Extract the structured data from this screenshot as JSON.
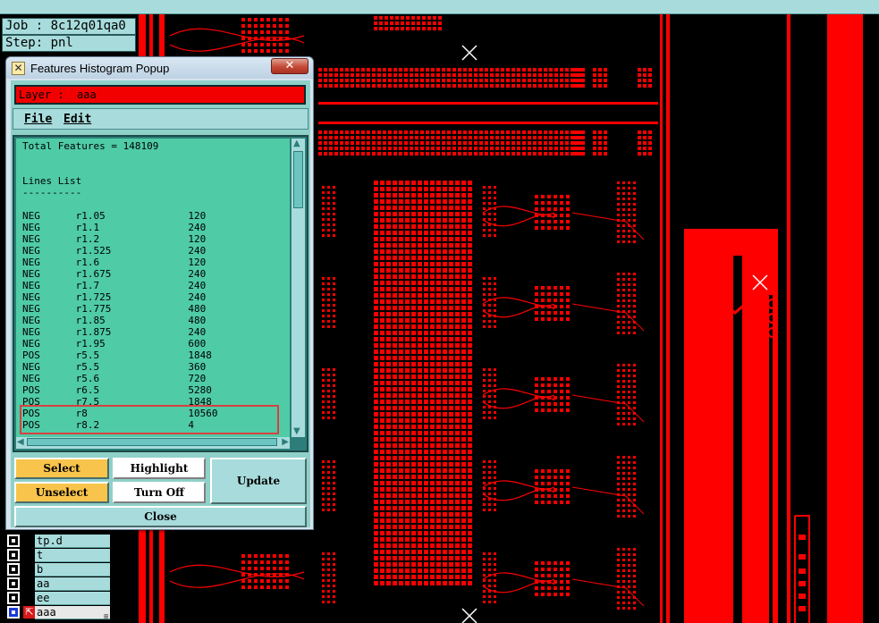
{
  "job": "Job : 8c12q01qa0",
  "step": "Step: pnl",
  "dialog": {
    "title": "Features Histogram Popup",
    "close_glyph": "✕",
    "layer_label": "Layer :  aaa",
    "menu": {
      "file": "File",
      "edit": "Edit"
    },
    "list_text": "Total Features = 148109\n\n\nLines List\n----------\n\nNEG      r1.05              120\nNEG      r1.1               240\nNEG      r1.2               120\nNEG      r1.525             240\nNEG      r1.6               120\nNEG      r1.675             240\nNEG      r1.7               240\nNEG      r1.725             240\nNEG      r1.775             480\nNEG      r1.85              480\nNEG      r1.875             240\nNEG      r1.95              600\nPOS      r5.5               1848\nNEG      r5.5               360\nNEG      r5.6               720\nPOS      r6.5               5280\nPOS      r7.5               1848\nPOS      r8                 10560\nPOS      r8.2               4",
    "buttons": {
      "select": "Select",
      "unselect": "Unselect",
      "highlight": "Highlight",
      "turn_off": "Turn Off",
      "update": "Update",
      "close": "Close"
    }
  },
  "layers": [
    "tp.d",
    "t",
    "b",
    "aa",
    "ee",
    "aaa"
  ],
  "colors": {
    "board": "#000000",
    "copper": "#ff0000",
    "panel": "#a8dcdc",
    "list_bg": "#4fcba6",
    "button_orange": "#f8c44c"
  }
}
